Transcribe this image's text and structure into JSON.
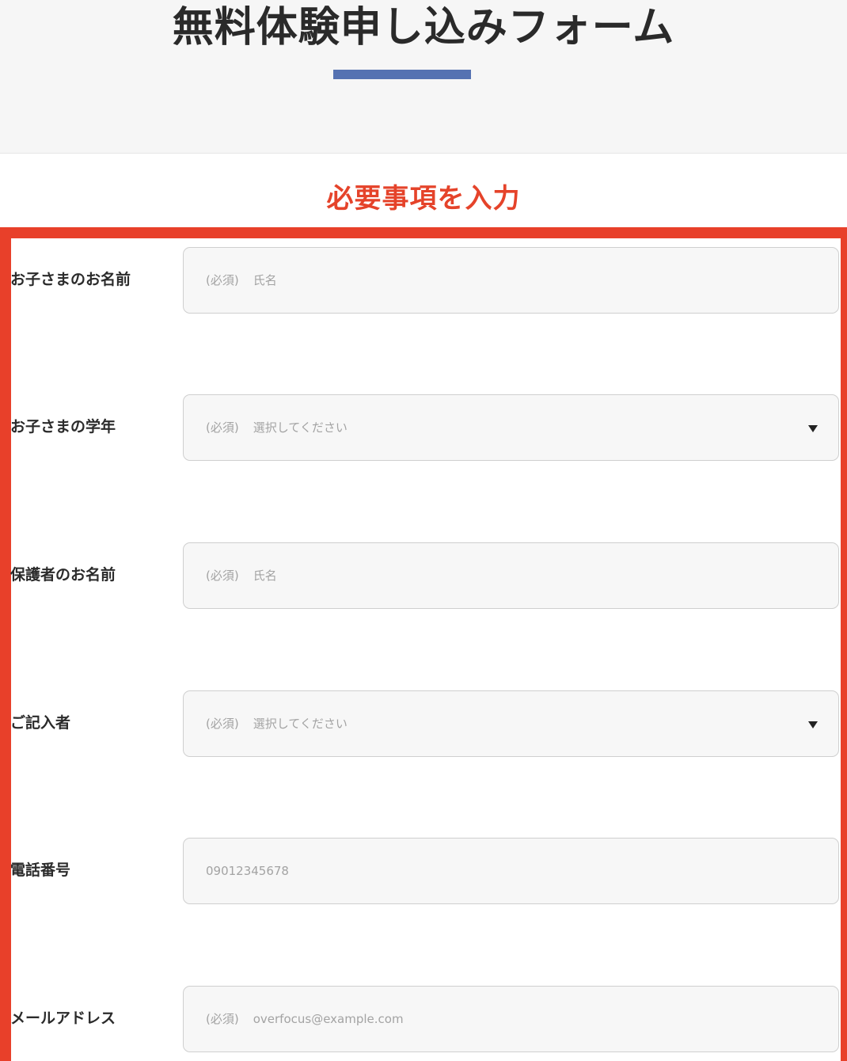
{
  "hero": {
    "title": "無料体験申し込みフォーム"
  },
  "section": {
    "heading": "必要事項を入力"
  },
  "colors": {
    "accent_red": "#e8402a",
    "heading_red": "#e5432a",
    "underline_blue": "#5572b2"
  },
  "form": {
    "fields": [
      {
        "label": "お子さまのお名前",
        "type": "text",
        "required_tag": "(必須)",
        "placeholder": "氏名"
      },
      {
        "label": "お子さまの学年",
        "type": "select",
        "required_tag": "(必須)",
        "placeholder": "選択してください",
        "icon": "dropdown-arrow-icon"
      },
      {
        "label": "保護者のお名前",
        "type": "text",
        "required_tag": "(必須)",
        "placeholder": "氏名"
      },
      {
        "label": "ご記入者",
        "type": "select",
        "required_tag": "(必須)",
        "placeholder": "選択してください",
        "icon": "dropdown-arrow-icon"
      },
      {
        "label": "電話番号",
        "type": "tel",
        "placeholder": "09012345678"
      },
      {
        "label": "メールアドレス",
        "type": "email",
        "required_tag": "(必須)",
        "placeholder": "overfocus@example.com"
      }
    ]
  }
}
